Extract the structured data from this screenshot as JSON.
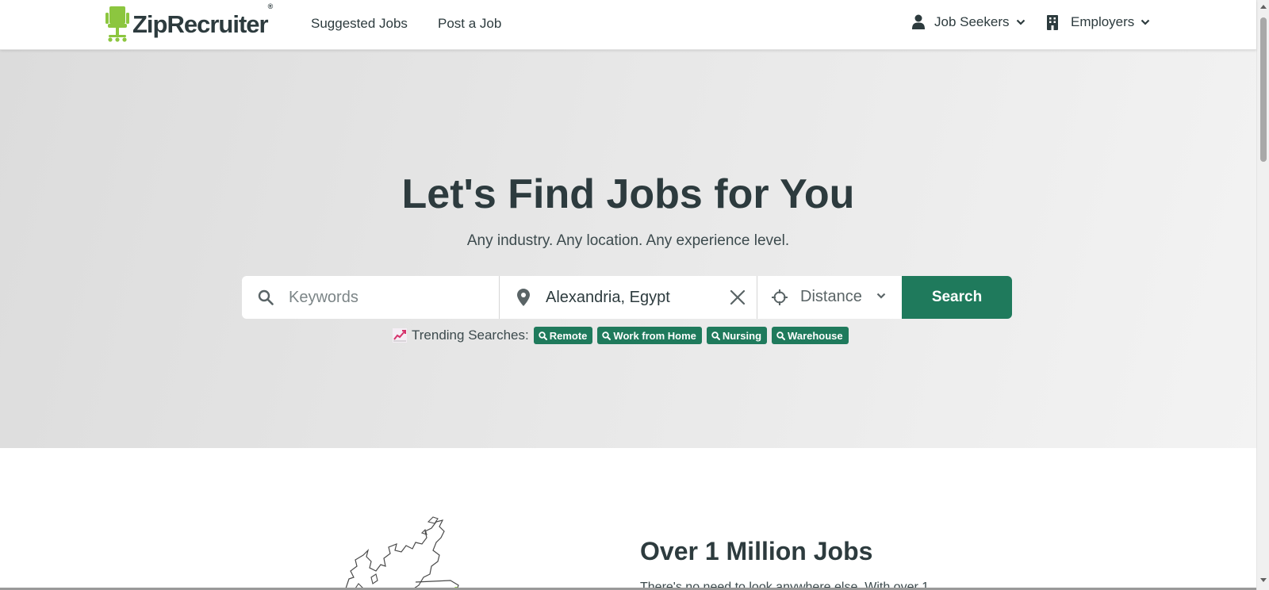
{
  "header": {
    "logo_text": "ZipRecruiter",
    "logo_reg": "®",
    "nav": {
      "suggested_jobs": "Suggested Jobs",
      "post_a_job": "Post a Job",
      "job_seekers": "Job Seekers",
      "employers": "Employers"
    }
  },
  "hero": {
    "title": "Let's Find Jobs for You",
    "subtitle": "Any industry. Any location. Any experience level.",
    "search": {
      "keywords_placeholder": "Keywords",
      "location_value": "Alexandria, Egypt",
      "distance_label": "Distance",
      "search_button": "Search"
    },
    "trending": {
      "label": "Trending Searches:",
      "items": [
        "Remote",
        "Work from Home",
        "Nursing",
        "Warehouse"
      ]
    }
  },
  "lower": {
    "title": "Over 1 Million Jobs",
    "text": "There's no need to look anywhere else. With over 1"
  },
  "colors": {
    "brand_green": "#1f7a5c",
    "logo_lime": "#8cc63f",
    "text_dark": "#2d3b3e"
  },
  "icons": {
    "logo": "chair-logo-icon",
    "job_seekers": "person-icon",
    "employers": "building-icon",
    "keywords": "search-icon",
    "location": "map-pin-icon",
    "clear": "close-icon",
    "distance": "crosshair-icon",
    "trending": "trending-chart-icon"
  }
}
